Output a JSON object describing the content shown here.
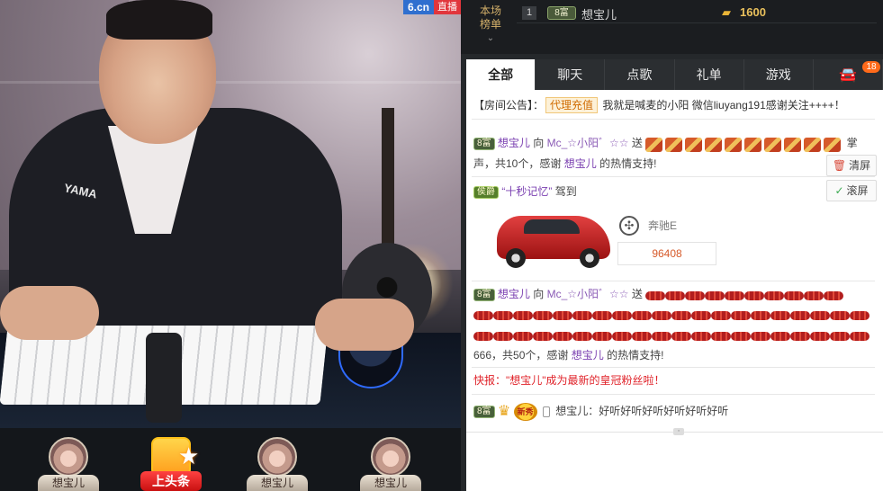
{
  "video": {
    "site_badge": "6.cn",
    "live_badge": "直播"
  },
  "gift_strip": {
    "slots": [
      {
        "name": "想宝儿"
      },
      {
        "name": "上头条"
      },
      {
        "name": "想宝儿"
      },
      {
        "name": "想宝儿"
      }
    ]
  },
  "rank": {
    "toggle_label_1": "本场",
    "toggle_label_2": "榜单",
    "rows": [
      {
        "rank": "1",
        "level": "8富",
        "name": "想宝儿",
        "coins": "1600"
      }
    ]
  },
  "tabs": [
    {
      "label": "全部"
    },
    {
      "label": "聊天"
    },
    {
      "label": "点歌"
    },
    {
      "label": "礼单"
    },
    {
      "label": "游戏"
    }
  ],
  "tab_car_badge": "18",
  "announcement": {
    "prefix": "【房间公告】：",
    "agent_btn": "代理充值",
    "text": "我就是喊麦的小阳 微信liuyang191感谢关注++++！"
  },
  "messages": {
    "m1": {
      "level": "8富",
      "user": "想宝儿",
      "to": "向",
      "target": "Mc_☆小阳゛☆☆",
      "send": "送",
      "tail": "掌",
      "line2_a": "声，共10个，感谢",
      "line2_user": "想宝儿",
      "line2_b": "的热情支持!"
    },
    "m2": {
      "vip": "侯爵",
      "user": "“十秒记忆”",
      "action": "驾到"
    },
    "car": {
      "name": "奔驰E",
      "number": "96408"
    },
    "m3": {
      "level": "8富",
      "user": "想宝儿",
      "to": "向",
      "target": "Mc_☆小阳゛☆☆",
      "send": "送",
      "line3_a": "666，共50个，感谢",
      "line3_user": "想宝儿",
      "line3_b": "的热情支持!"
    },
    "flash": "快报：\"想宝儿\"成为最新的皇冠粉丝啦！",
    "m4": {
      "level": "8富",
      "new_badge": "新秀",
      "user": "想宝儿",
      "text": "：好听好听好听好听好听好听"
    }
  },
  "side_buttons": {
    "clear": "清屏",
    "scroll": "滚屏"
  },
  "colors": {
    "accent_red": "#e0232a",
    "coin_gold": "#e9c05c",
    "username_purple": "#7a3fb0"
  }
}
